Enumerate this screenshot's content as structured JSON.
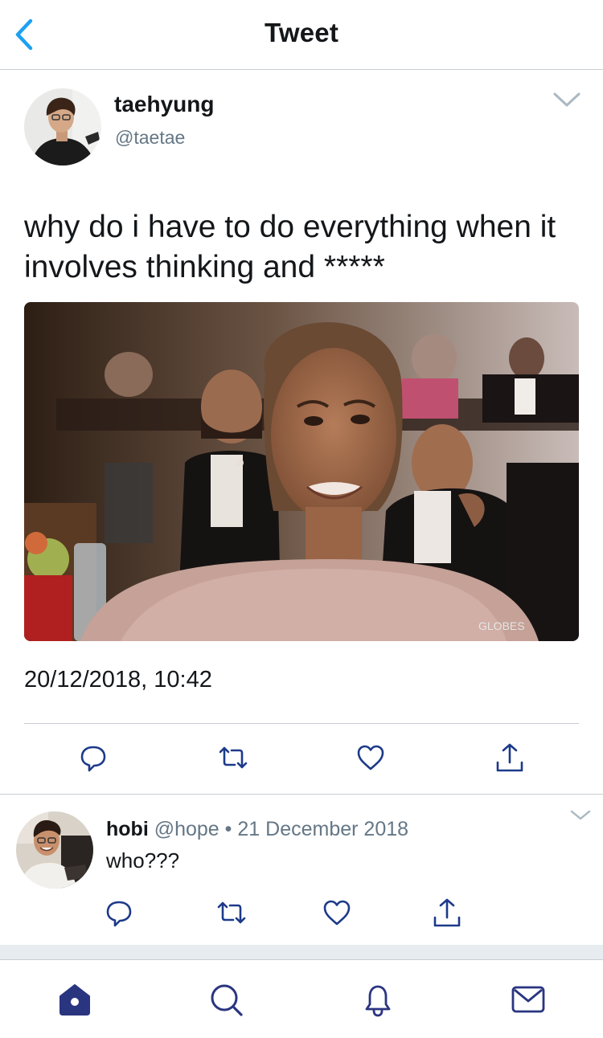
{
  "header": {
    "title": "Tweet",
    "back_icon": "chevron-left-icon"
  },
  "colors": {
    "accent": "#1da1f2",
    "nav_active": "#2a3580",
    "icon_gray": "#657786",
    "text": "#14171a",
    "divider": "#c8cdd2"
  },
  "tweet": {
    "name": "taehyung",
    "handle": "@taetae",
    "text": "why do i have to do everything when it involves thinking and *****",
    "media_watermark": "GLOBES",
    "timestamp": "20/12/2018, 10:42",
    "actions": [
      "reply-icon",
      "retweet-icon",
      "like-icon",
      "share-icon"
    ]
  },
  "reply": {
    "name": "hobi",
    "handle": "@hope",
    "separator": "•",
    "date": "21 December 2018",
    "text": "who???",
    "actions": [
      "reply-icon",
      "retweet-icon",
      "like-icon",
      "share-icon"
    ]
  },
  "tabbar": {
    "items": [
      "home-icon",
      "search-icon",
      "notifications-icon",
      "messages-icon"
    ],
    "active": "home-icon"
  }
}
